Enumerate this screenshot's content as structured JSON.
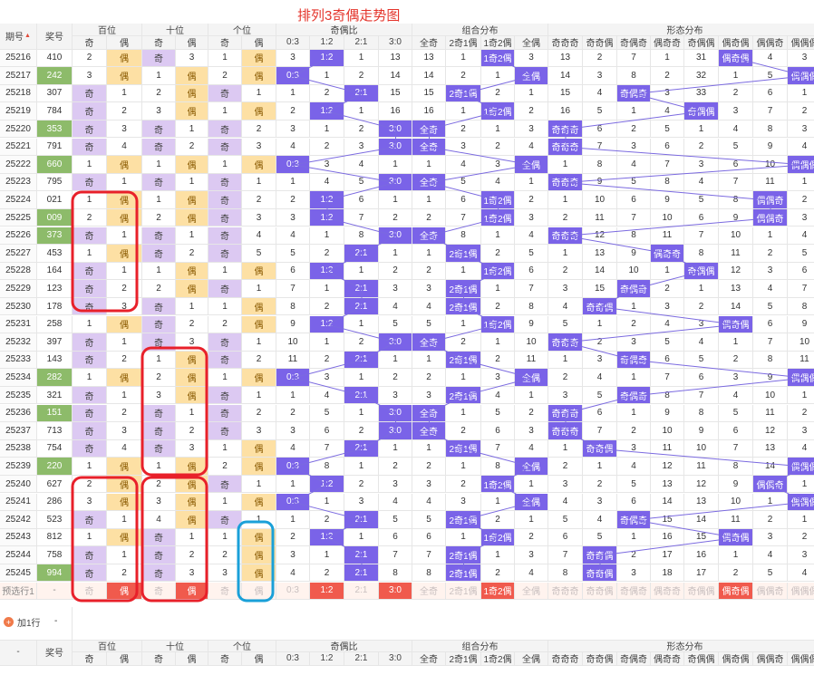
{
  "page": {
    "title": "排列3奇偶走势图"
  },
  "header": {
    "issue_label": "期号",
    "number_label": "奖号",
    "groups": [
      "百位",
      "十位",
      "个位",
      "奇偶比",
      "组合分布",
      "形态分布"
    ],
    "pos_labels": [
      "奇",
      "偶"
    ],
    "ratio_labels": [
      "0:3",
      "1:2",
      "2:1",
      "3:0"
    ],
    "combo_labels": [
      "全奇",
      "2奇1偶",
      "1奇2偶",
      "全偶"
    ],
    "shape_labels": [
      "奇奇奇",
      "奇奇偶",
      "奇偶奇",
      "偶奇奇",
      "奇偶偶",
      "偶奇偶",
      "偶偶奇",
      "偶偶偶"
    ]
  },
  "draws": [
    {
      "issue": "25216",
      "num": "410",
      "hit": false,
      "bai": [
        2,
        "偶"
      ],
      "shi": [
        "奇",
        3
      ],
      "ge": [
        1,
        "偶"
      ],
      "ratio": [
        3,
        "1:2",
        1,
        13
      ],
      "combo": [
        13,
        1,
        "1奇2偶",
        3
      ],
      "shape": [
        13,
        2,
        7,
        1,
        31,
        "偶奇偶",
        4,
        3
      ]
    },
    {
      "issue": "25217",
      "num": "242",
      "hit": true,
      "bai": [
        3,
        "偶"
      ],
      "shi": [
        1,
        "偶"
      ],
      "ge": [
        2,
        "偶"
      ],
      "ratio": [
        "0:3",
        1,
        2,
        14
      ],
      "combo": [
        14,
        2,
        1,
        "全偶"
      ],
      "shape": [
        14,
        3,
        8,
        2,
        32,
        1,
        5,
        "偶偶偶"
      ]
    },
    {
      "issue": "25218",
      "num": "307",
      "hit": false,
      "bai": [
        "奇",
        1
      ],
      "shi": [
        2,
        "偶"
      ],
      "ge": [
        "奇",
        1
      ],
      "ratio": [
        1,
        2,
        "2:1",
        15
      ],
      "combo": [
        15,
        "2奇1偶",
        2,
        1
      ],
      "shape": [
        15,
        4,
        "奇偶奇",
        3,
        33,
        2,
        6,
        1
      ]
    },
    {
      "issue": "25219",
      "num": "784",
      "hit": false,
      "bai": [
        "奇",
        2
      ],
      "shi": [
        3,
        "偶"
      ],
      "ge": [
        1,
        "偶"
      ],
      "ratio": [
        2,
        "1:2",
        1,
        16
      ],
      "combo": [
        16,
        1,
        "1奇2偶",
        2
      ],
      "shape": [
        16,
        5,
        1,
        4,
        "奇偶偶",
        3,
        7,
        2
      ]
    },
    {
      "issue": "25220",
      "num": "353",
      "hit": true,
      "bai": [
        "奇",
        3
      ],
      "shi": [
        "奇",
        1
      ],
      "ge": [
        "奇",
        2
      ],
      "ratio": [
        3,
        1,
        2,
        "3:0"
      ],
      "combo": [
        "全奇",
        2,
        1,
        3
      ],
      "shape": [
        "奇奇奇",
        6,
        2,
        5,
        1,
        4,
        8,
        3
      ]
    },
    {
      "issue": "25221",
      "num": "791",
      "hit": false,
      "bai": [
        "奇",
        4
      ],
      "shi": [
        "奇",
        2
      ],
      "ge": [
        "奇",
        3
      ],
      "ratio": [
        4,
        2,
        3,
        "3:0"
      ],
      "combo": [
        "全奇",
        3,
        2,
        4
      ],
      "shape": [
        "奇奇奇",
        7,
        3,
        6,
        2,
        5,
        9,
        4
      ]
    },
    {
      "issue": "25222",
      "num": "660",
      "hit": true,
      "bai": [
        1,
        "偶"
      ],
      "shi": [
        1,
        "偶"
      ],
      "ge": [
        1,
        "偶"
      ],
      "ratio": [
        "0:3",
        3,
        4,
        1
      ],
      "combo": [
        1,
        4,
        3,
        "全偶"
      ],
      "shape": [
        1,
        8,
        4,
        7,
        3,
        6,
        10,
        "偶偶偶"
      ]
    },
    {
      "issue": "25223",
      "num": "795",
      "hit": false,
      "bai": [
        "奇",
        1
      ],
      "shi": [
        "奇",
        1
      ],
      "ge": [
        "奇",
        1
      ],
      "ratio": [
        1,
        4,
        5,
        "3:0"
      ],
      "combo": [
        "全奇",
        5,
        4,
        1
      ],
      "shape": [
        "奇奇奇",
        9,
        5,
        8,
        4,
        7,
        11,
        1
      ]
    },
    {
      "issue": "25224",
      "num": "021",
      "hit": false,
      "bai": [
        1,
        "偶"
      ],
      "shi": [
        1,
        "偶"
      ],
      "ge": [
        "奇",
        2
      ],
      "ratio": [
        2,
        "1:2",
        6,
        1
      ],
      "combo": [
        1,
        6,
        "1奇2偶",
        2
      ],
      "shape": [
        1,
        10,
        6,
        9,
        5,
        8,
        "偶偶奇",
        2
      ]
    },
    {
      "issue": "25225",
      "num": "009",
      "hit": true,
      "bai": [
        2,
        "偶"
      ],
      "shi": [
        2,
        "偶"
      ],
      "ge": [
        "奇",
        3
      ],
      "ratio": [
        3,
        "1:2",
        7,
        2
      ],
      "combo": [
        2,
        7,
        "1奇2偶",
        3
      ],
      "shape": [
        2,
        11,
        7,
        10,
        6,
        9,
        "偶偶奇",
        3
      ]
    },
    {
      "issue": "25226",
      "num": "373",
      "hit": true,
      "bai": [
        "奇",
        1
      ],
      "shi": [
        "奇",
        1
      ],
      "ge": [
        "奇",
        4
      ],
      "ratio": [
        4,
        1,
        8,
        "3:0"
      ],
      "combo": [
        "全奇",
        8,
        1,
        4
      ],
      "shape": [
        "奇奇奇",
        12,
        8,
        11,
        7,
        10,
        1,
        4
      ]
    },
    {
      "issue": "25227",
      "num": "453",
      "hit": false,
      "bai": [
        1,
        "偶"
      ],
      "shi": [
        "奇",
        2
      ],
      "ge": [
        "奇",
        5
      ],
      "ratio": [
        5,
        2,
        "2:1",
        1
      ],
      "combo": [
        1,
        "2奇1偶",
        2,
        5
      ],
      "shape": [
        1,
        13,
        9,
        "偶奇奇",
        8,
        11,
        2,
        5
      ]
    },
    {
      "issue": "25228",
      "num": "164",
      "hit": false,
      "bai": [
        "奇",
        1
      ],
      "shi": [
        1,
        "偶"
      ],
      "ge": [
        1,
        "偶"
      ],
      "ratio": [
        6,
        "1:2",
        1,
        2
      ],
      "combo": [
        2,
        1,
        "1奇2偶",
        6
      ],
      "shape": [
        2,
        14,
        10,
        1,
        "奇偶偶",
        12,
        3,
        6
      ]
    },
    {
      "issue": "25229",
      "num": "123",
      "hit": false,
      "bai": [
        "奇",
        2
      ],
      "shi": [
        2,
        "偶"
      ],
      "ge": [
        "奇",
        1
      ],
      "ratio": [
        7,
        1,
        "2:1",
        3
      ],
      "combo": [
        3,
        "2奇1偶",
        1,
        7
      ],
      "shape": [
        3,
        15,
        "奇偶奇",
        2,
        1,
        13,
        4,
        7
      ]
    },
    {
      "issue": "25230",
      "num": "178",
      "hit": false,
      "bai": [
        "奇",
        3
      ],
      "shi": [
        "奇",
        1
      ],
      "ge": [
        1,
        "偶"
      ],
      "ratio": [
        8,
        2,
        "2:1",
        4
      ],
      "combo": [
        4,
        "2奇1偶",
        2,
        8
      ],
      "shape": [
        4,
        "奇奇偶",
        1,
        3,
        2,
        14,
        5,
        8
      ]
    },
    {
      "issue": "25231",
      "num": "258",
      "hit": false,
      "bai": [
        1,
        "偶"
      ],
      "shi": [
        "奇",
        2
      ],
      "ge": [
        2,
        "偶"
      ],
      "ratio": [
        9,
        "1:2",
        1,
        5
      ],
      "combo": [
        5,
        1,
        "1奇2偶",
        9
      ],
      "shape": [
        5,
        1,
        2,
        4,
        3,
        "偶奇偶",
        6,
        9
      ]
    },
    {
      "issue": "25232",
      "num": "397",
      "hit": false,
      "bai": [
        "奇",
        1
      ],
      "shi": [
        "奇",
        3
      ],
      "ge": [
        "奇",
        1
      ],
      "ratio": [
        10,
        1,
        2,
        "3:0"
      ],
      "combo": [
        "全奇",
        2,
        1,
        10
      ],
      "shape": [
        "奇奇奇",
        2,
        3,
        5,
        4,
        1,
        7,
        10
      ]
    },
    {
      "issue": "25233",
      "num": "143",
      "hit": false,
      "bai": [
        "奇",
        2
      ],
      "shi": [
        1,
        "偶"
      ],
      "ge": [
        "奇",
        2
      ],
      "ratio": [
        11,
        2,
        "2:1",
        1
      ],
      "combo": [
        1,
        "2奇1偶",
        2,
        11
      ],
      "shape": [
        1,
        3,
        "奇偶奇",
        6,
        5,
        2,
        8,
        11
      ]
    },
    {
      "issue": "25234",
      "num": "282",
      "hit": true,
      "bai": [
        1,
        "偶"
      ],
      "shi": [
        2,
        "偶"
      ],
      "ge": [
        1,
        "偶"
      ],
      "ratio": [
        "0:3",
        3,
        1,
        2
      ],
      "combo": [
        2,
        1,
        3,
        "全偶"
      ],
      "shape": [
        2,
        4,
        1,
        7,
        6,
        3,
        9,
        "偶偶偶"
      ]
    },
    {
      "issue": "25235",
      "num": "321",
      "hit": false,
      "bai": [
        "奇",
        1
      ],
      "shi": [
        3,
        "偶"
      ],
      "ge": [
        "奇",
        1
      ],
      "ratio": [
        1,
        4,
        "2:1",
        3
      ],
      "combo": [
        3,
        "2奇1偶",
        4,
        1
      ],
      "shape": [
        3,
        5,
        "奇偶奇",
        8,
        7,
        4,
        10,
        1
      ]
    },
    {
      "issue": "25236",
      "num": "151",
      "hit": true,
      "bai": [
        "奇",
        2
      ],
      "shi": [
        "奇",
        1
      ],
      "ge": [
        "奇",
        2
      ],
      "ratio": [
        2,
        5,
        1,
        "3:0"
      ],
      "combo": [
        "全奇",
        1,
        5,
        2
      ],
      "shape": [
        "奇奇奇",
        6,
        1,
        9,
        8,
        5,
        11,
        2
      ]
    },
    {
      "issue": "25237",
      "num": "713",
      "hit": false,
      "bai": [
        "奇",
        3
      ],
      "shi": [
        "奇",
        2
      ],
      "ge": [
        "奇",
        3
      ],
      "ratio": [
        3,
        6,
        2,
        "3:0"
      ],
      "combo": [
        "全奇",
        2,
        6,
        3
      ],
      "shape": [
        "奇奇奇",
        7,
        2,
        10,
        9,
        6,
        12,
        3
      ]
    },
    {
      "issue": "25238",
      "num": "754",
      "hit": false,
      "bai": [
        "奇",
        4
      ],
      "shi": [
        "奇",
        3
      ],
      "ge": [
        1,
        "偶"
      ],
      "ratio": [
        4,
        7,
        "2:1",
        1
      ],
      "combo": [
        1,
        "2奇1偶",
        7,
        4
      ],
      "shape": [
        1,
        "奇奇偶",
        3,
        11,
        10,
        7,
        13,
        4
      ]
    },
    {
      "issue": "25239",
      "num": "220",
      "hit": true,
      "bai": [
        1,
        "偶"
      ],
      "shi": [
        1,
        "偶"
      ],
      "ge": [
        2,
        "偶"
      ],
      "ratio": [
        "0:3",
        8,
        1,
        2
      ],
      "combo": [
        2,
        1,
        8,
        "全偶"
      ],
      "shape": [
        2,
        1,
        4,
        12,
        11,
        8,
        14,
        "偶偶偶"
      ]
    },
    {
      "issue": "25240",
      "num": "627",
      "hit": false,
      "bai": [
        2,
        "偶"
      ],
      "shi": [
        2,
        "偶"
      ],
      "ge": [
        "奇",
        1
      ],
      "ratio": [
        1,
        "1:2",
        2,
        3
      ],
      "combo": [
        3,
        2,
        "1奇2偶",
        1
      ],
      "shape": [
        3,
        2,
        5,
        13,
        12,
        9,
        "偶偶奇",
        1
      ]
    },
    {
      "issue": "25241",
      "num": "286",
      "hit": false,
      "bai": [
        3,
        "偶"
      ],
      "shi": [
        3,
        "偶"
      ],
      "ge": [
        1,
        "偶"
      ],
      "ratio": [
        "0:3",
        1,
        3,
        4
      ],
      "combo": [
        4,
        3,
        1,
        "全偶"
      ],
      "shape": [
        4,
        3,
        6,
        14,
        13,
        10,
        1,
        "偶偶偶"
      ]
    },
    {
      "issue": "25242",
      "num": "523",
      "hit": false,
      "bai": [
        "奇",
        1
      ],
      "shi": [
        4,
        "偶"
      ],
      "ge": [
        "奇",
        1
      ],
      "ratio": [
        1,
        2,
        "2:1",
        5
      ],
      "combo": [
        5,
        "2奇1偶",
        2,
        1
      ],
      "shape": [
        5,
        4,
        "奇偶奇",
        15,
        14,
        11,
        2,
        1
      ]
    },
    {
      "issue": "25243",
      "num": "812",
      "hit": false,
      "bai": [
        1,
        "偶"
      ],
      "shi": [
        "奇",
        1
      ],
      "ge": [
        1,
        "偶"
      ],
      "ratio": [
        2,
        "1:2",
        1,
        6
      ],
      "combo": [
        6,
        1,
        "1奇2偶",
        2
      ],
      "shape": [
        6,
        5,
        1,
        16,
        15,
        "偶奇偶",
        3,
        2
      ]
    },
    {
      "issue": "25244",
      "num": "758",
      "hit": false,
      "bai": [
        "奇",
        1
      ],
      "shi": [
        "奇",
        2
      ],
      "ge": [
        2,
        "偶"
      ],
      "ratio": [
        3,
        1,
        "2:1",
        7
      ],
      "combo": [
        7,
        "2奇1偶",
        1,
        3
      ],
      "shape": [
        7,
        "奇奇偶",
        2,
        17,
        16,
        1,
        4,
        3
      ]
    },
    {
      "issue": "25245",
      "num": "994",
      "hit": true,
      "bai": [
        "奇",
        2
      ],
      "shi": [
        "奇",
        3
      ],
      "ge": [
        3,
        "偶"
      ],
      "ratio": [
        4,
        2,
        "2:1",
        8
      ],
      "combo": [
        8,
        "2奇1偶",
        2,
        4
      ],
      "shape": [
        8,
        "奇奇偶",
        3,
        18,
        17,
        2,
        5,
        4
      ]
    }
  ],
  "preselect": {
    "label": "预选行1",
    "dash": "-",
    "bai": [
      "奇",
      "偶"
    ],
    "shi": [
      "奇",
      "偶"
    ],
    "ge": [
      "奇",
      "偶"
    ],
    "ratio": [
      "0:3",
      "1:2",
      "2:1",
      "3:0"
    ],
    "combo": [
      "全奇",
      "2奇1偶",
      "1奇2偶",
      "全偶"
    ],
    "shape": [
      "奇奇奇",
      "奇奇偶",
      "奇偶奇",
      "偶奇奇",
      "奇偶偶",
      "偶奇偶",
      "偶偶奇",
      "偶偶偶"
    ],
    "active": [
      0,
      1,
      0,
      1,
      0,
      0,
      0,
      1,
      0,
      1,
      0,
      0,
      1,
      0,
      0,
      0,
      0,
      0,
      0,
      1,
      0,
      0,
      0
    ]
  },
  "add_row": {
    "label": "加1行",
    "dash": "-"
  },
  "footer": {
    "dash": "-",
    "number_label": "奖号"
  },
  "colors": {
    "odd": "#dcc9f2",
    "even": "#fde0a4",
    "marker": "#7a63e8",
    "hit": "#8dbb6a",
    "line": "#7b6ae0",
    "circle_red": "#e8202a",
    "circle_blue": "#1aa0d8",
    "title": "#e4342b"
  }
}
